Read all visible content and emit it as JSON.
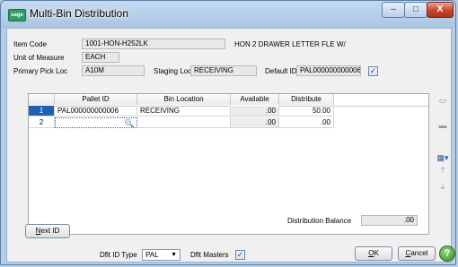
{
  "window": {
    "app_icon": "sage",
    "title": "Multi-Bin Distribution",
    "min_glyph": "–",
    "max_glyph": "□",
    "close_glyph": "X"
  },
  "header": {
    "item_code_label": "Item Code",
    "item_code_value": "1001-HON-H252LK",
    "item_description": "HON 2 DRAWER LETTER FLE W/",
    "uom_label": "Unit of Measure",
    "uom_value": "EACH",
    "primary_pick_label": "Primary Pick Loc",
    "primary_pick_value": "A10M",
    "staging_label": "Staging Loc",
    "staging_value": "RECEIVING",
    "default_id_label": "Default ID",
    "default_id_value": "PAL000000000006",
    "default_id_checked": true
  },
  "grid": {
    "columns": [
      "Pallet ID",
      "Bin Location",
      "Available",
      "Distribute"
    ],
    "rows": [
      {
        "num": "1",
        "pallet_id": "PAL000000000006",
        "bin_location": "RECEIVING",
        "available": ".00",
        "distribute": "50.00"
      },
      {
        "num": "2",
        "pallet_id": "",
        "bin_location": "",
        "available": ".00",
        "distribute": ".00"
      }
    ]
  },
  "footer": {
    "next_id_label_u": "N",
    "next_id_label_rest": "ext ID",
    "distribution_balance_label": "Distribution Balance",
    "distribution_balance_value": ".00",
    "dflt_id_type_label": "Dflt ID Type",
    "dflt_id_type_value": "PAL",
    "dflt_masters_label": "Dflt Masters",
    "dflt_masters_checked": true,
    "ok_u": "O",
    "ok_rest": "K",
    "cancel_u": "C",
    "cancel_rest": "ancel",
    "help_glyph": "?"
  }
}
